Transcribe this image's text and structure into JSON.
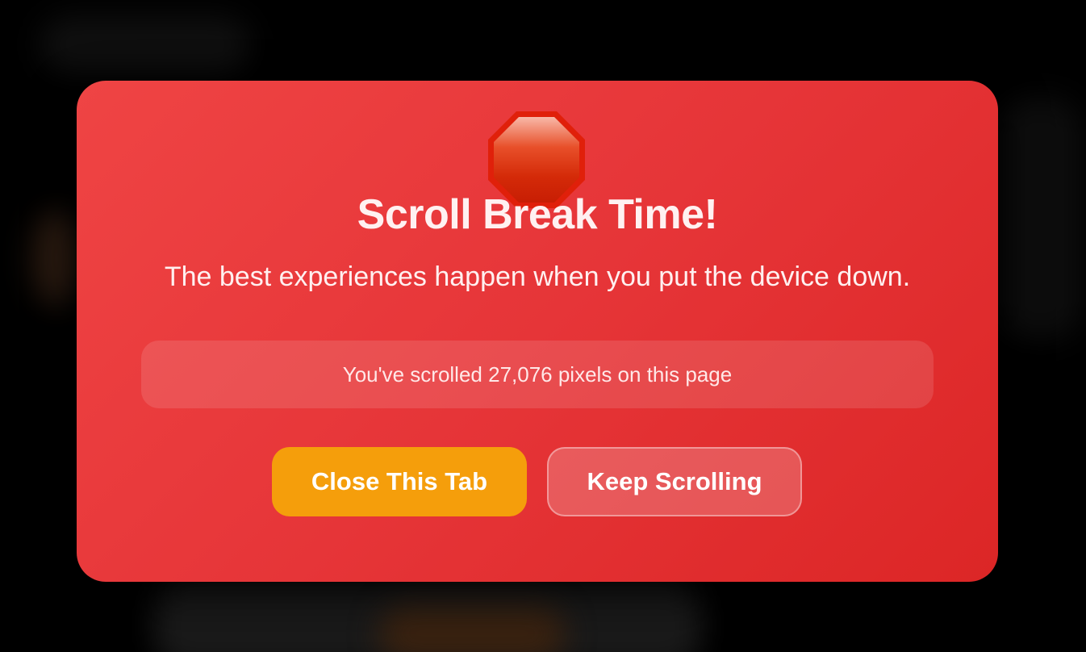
{
  "modal": {
    "icon": "stop-sign-icon",
    "title": "Scroll Break Time!",
    "subtitle": "The best experiences happen when you put the device down.",
    "counter_text": "You've scrolled 27,076 pixels on this page",
    "buttons": {
      "close_label": "Close This Tab",
      "keep_label": "Keep Scrolling"
    },
    "colors": {
      "modal_background": "#e63538",
      "primary_button": "#f59e0b",
      "stop_sign": "#dc2a0e"
    }
  }
}
